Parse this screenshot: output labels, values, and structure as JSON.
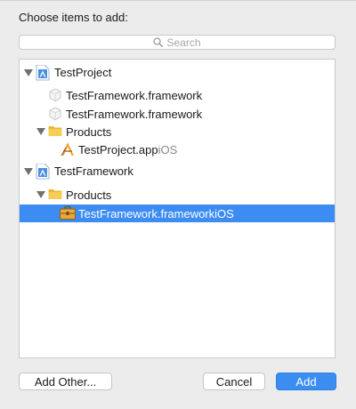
{
  "dialog": {
    "heading": "Choose items to add:",
    "search_placeholder": "Search"
  },
  "tree": {
    "project1": {
      "name": "TestProject",
      "icon": "xcode-project-icon"
    },
    "project1_item1": {
      "name": "TestFramework.framework",
      "icon": "framework-icon"
    },
    "project1_item2": {
      "name": "TestFramework.framework",
      "icon": "framework-icon"
    },
    "project1_products": {
      "name": "Products",
      "icon": "folder-icon"
    },
    "project1_app": {
      "name": "TestProject.app",
      "platform": "iOS",
      "icon": "app-icon"
    },
    "project2": {
      "name": "TestFramework",
      "icon": "xcode-project-icon"
    },
    "project2_products": {
      "name": "Products",
      "icon": "folder-icon"
    },
    "project2_framework": {
      "name": "TestFramework.framework",
      "platform": "iOS",
      "icon": "toolbox-icon",
      "selected": true
    }
  },
  "buttons": {
    "add_other": "Add Other...",
    "cancel": "Cancel",
    "add": "Add"
  },
  "colors": {
    "selection": "#3c8cf4",
    "default_button": "#3b8ef0",
    "folder": "#f5c84a",
    "project_icon": "#4a90e2"
  }
}
